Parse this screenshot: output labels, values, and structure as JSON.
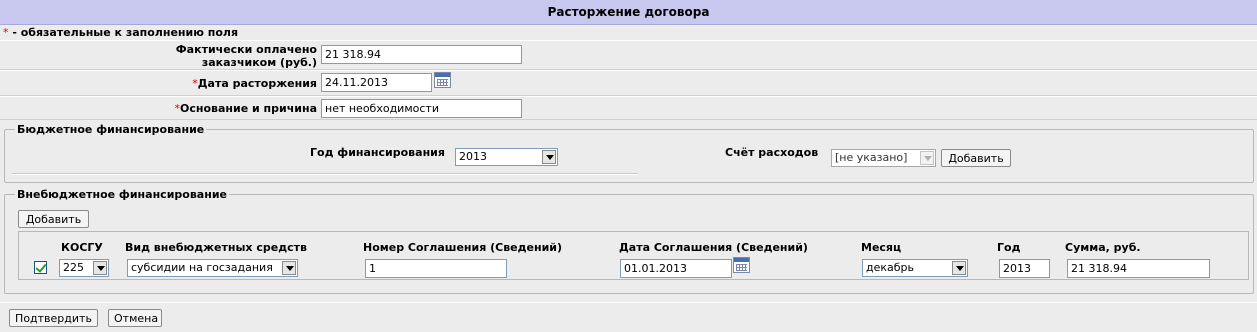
{
  "title": "Расторжение договора",
  "required_note": {
    "star": "*",
    "text": " - обязательные к заполнению поля"
  },
  "fields": {
    "paid": {
      "label_line1": "Фактически оплачено",
      "label_line2": "заказчиком (руб.)",
      "value": "21 318.94"
    },
    "date": {
      "star": "*",
      "label": "Дата расторжения",
      "value": "24.11.2013",
      "icon": "calendar-icon"
    },
    "reason": {
      "star": "*",
      "label": "Основание и причина",
      "value": "нет необходимости"
    }
  },
  "budget": {
    "legend": "Бюджетное финансирование",
    "year_label": "Год финансирования",
    "year_value": "2013",
    "account_label": "Счёт расходов",
    "account_value": "[не указано]",
    "add_button": "Добавить"
  },
  "offbudget": {
    "legend": "Внебюджетное финансирование",
    "add_button": "Добавить",
    "columns": [
      "КОСГУ",
      "Вид внебюджетных средств",
      "Номер Соглашения (Сведений)",
      "Дата Соглашения (Сведений)",
      "Месяц",
      "Год",
      "Сумма, руб."
    ],
    "row": {
      "checked": true,
      "kosgu": "225",
      "fund_type": "субсидии на госзадания",
      "agreement_number": "1",
      "agreement_date": "01.01.2013",
      "month": "декабрь",
      "year": "2013",
      "amount": "21 318.94"
    }
  },
  "actions": {
    "confirm": "Подтвердить",
    "cancel": "Отмена"
  },
  "colors": {
    "header_bg": "#c8c8ee",
    "page_bg": "#ececec",
    "required_star": "#e00000"
  }
}
